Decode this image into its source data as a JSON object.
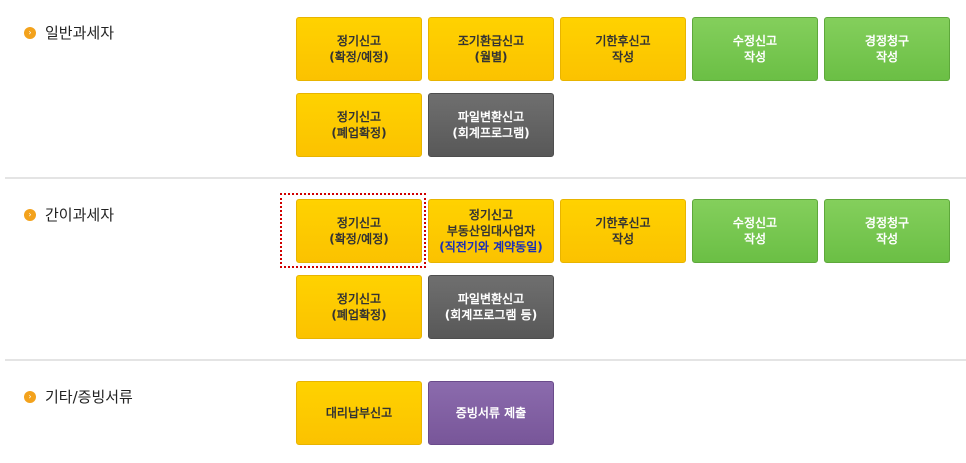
{
  "sections": [
    {
      "label": "일반과세자",
      "buttons": [
        {
          "lines": [
            "정기신고",
            "(확정/예정)"
          ]
        },
        {
          "lines": [
            "조기환급신고",
            "(월별)"
          ]
        },
        {
          "lines": [
            "기한후신고",
            "작성"
          ]
        },
        {
          "lines": [
            "수정신고",
            "작성"
          ]
        },
        {
          "lines": [
            "경정청구",
            "작성"
          ]
        },
        {
          "lines": [
            "정기신고",
            "(폐업확정)"
          ]
        },
        {
          "lines": [
            "파일변환신고",
            "(회계프로그램)"
          ]
        }
      ]
    },
    {
      "label": "간이과세자",
      "buttons": [
        {
          "lines": [
            "정기신고",
            "(확정/예정)"
          ]
        },
        {
          "lines": [
            "정기신고",
            "부동산임대사업자",
            "(직전기와 계약동일)"
          ]
        },
        {
          "lines": [
            "기한후신고",
            "작성"
          ]
        },
        {
          "lines": [
            "수정신고",
            "작성"
          ]
        },
        {
          "lines": [
            "경정청구",
            "작성"
          ]
        },
        {
          "lines": [
            "정기신고",
            "(폐업확정)"
          ]
        },
        {
          "lines": [
            "파일변환신고",
            "(회계프로그램 등)"
          ]
        }
      ]
    },
    {
      "label": "기타/증빙서류",
      "buttons": [
        {
          "lines": [
            "대리납부신고"
          ]
        },
        {
          "lines": [
            "증빙서류 제출"
          ]
        }
      ]
    }
  ],
  "colors": {
    "yellow": "#fbc200",
    "green": "#6bbf45",
    "gray": "#585858",
    "purple": "#785699",
    "bullet": "#f3a21c",
    "focus_outline": "#d00000",
    "highlight_text": "#1a2fb8"
  }
}
